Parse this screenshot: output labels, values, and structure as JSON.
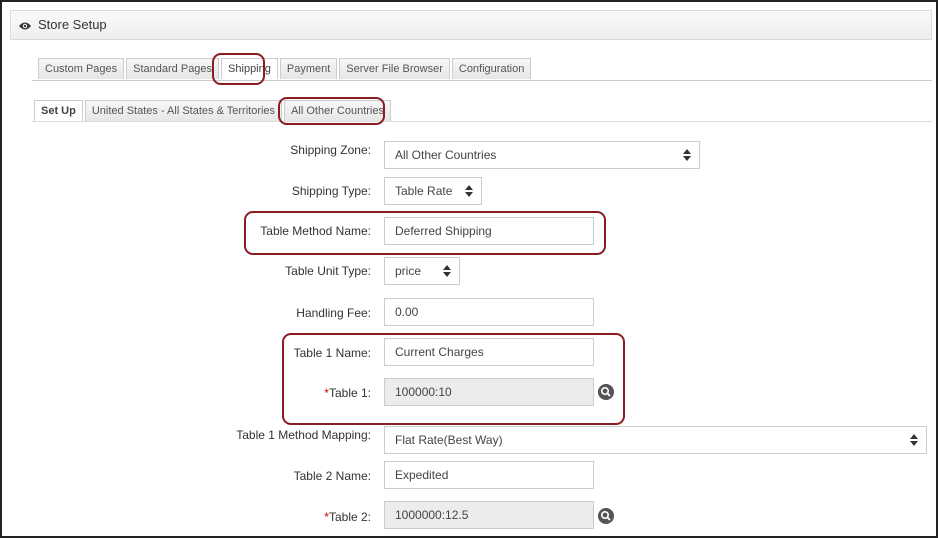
{
  "header": {
    "title": "Store Setup",
    "icon": "eye-icon"
  },
  "outer_tabs": [
    "Custom Pages",
    "Standard Pages",
    "Shipping",
    "Payment",
    "Server File Browser",
    "Configuration"
  ],
  "inner_tabs": [
    "Set Up",
    "United States - All States & Territories",
    "All Other Countries"
  ],
  "form": {
    "shipping_zone": {
      "label": "Shipping Zone:",
      "value": "All Other Countries"
    },
    "shipping_type": {
      "label": "Shipping Type:",
      "value": "Table Rate"
    },
    "table_method_name": {
      "label": "Table Method Name:",
      "value": "Deferred Shipping"
    },
    "table_unit_type": {
      "label": "Table Unit Type:",
      "value": "price"
    },
    "handling_fee": {
      "label": "Handling Fee:",
      "value": "0.00"
    },
    "table1_name": {
      "label": "Table 1 Name:",
      "value": "Current Charges"
    },
    "table1": {
      "required_mark": "*",
      "label": "Table 1:",
      "value": "100000:10"
    },
    "table1_method_mapping": {
      "label": "Table 1 Method Mapping:",
      "value": "Flat Rate(Best Way)"
    },
    "table2_name": {
      "label": "Table 2 Name:",
      "value": "Expedited"
    },
    "table2": {
      "required_mark": "*",
      "label": "Table 2:",
      "value": "1000000:12.5"
    }
  },
  "colors": {
    "highlight": "#8b1c24",
    "required": "#cc0000"
  }
}
